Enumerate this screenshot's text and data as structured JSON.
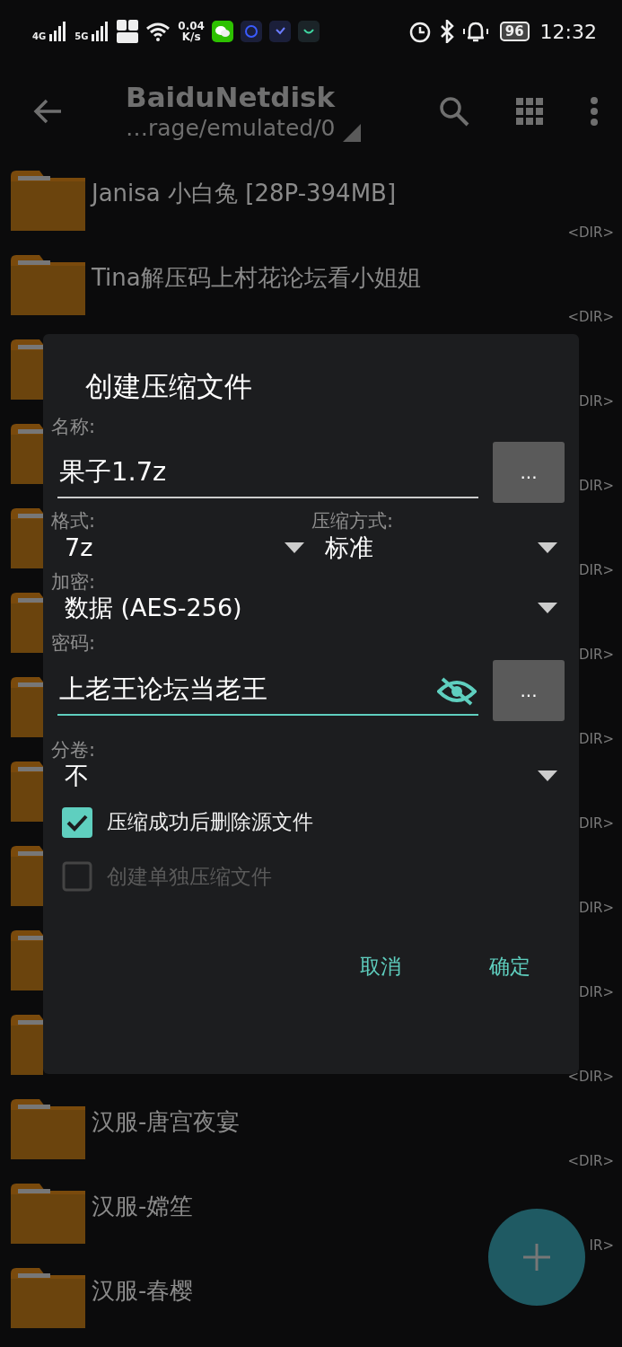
{
  "status_bar": {
    "networks": [
      "4G",
      "5G"
    ],
    "speed": "0.04",
    "speed_unit": "K/s",
    "battery": "96",
    "time": "12:32"
  },
  "app_bar": {
    "title": "BaiduNetdisk",
    "path": "…rage/emulated/0"
  },
  "files": [
    {
      "name": "Janisa 小白兔 [28P-394MB]",
      "dir": "<DIR>"
    },
    {
      "name": "Tina解压码上村花论坛看小姐姐",
      "dir": "<DIR>"
    },
    {
      "dir": "DIR>"
    },
    {
      "dir": "DIR>"
    },
    {
      "dir": "DIR>"
    },
    {
      "dir": "DIR>"
    },
    {
      "dir": "DIR>"
    },
    {
      "dir": "DIR>"
    },
    {
      "dir": "DIR>"
    },
    {
      "dir": "DIR>"
    },
    {
      "dir": "<DIR>"
    },
    {
      "name": "汉服-唐宫夜宴",
      "dir": "<DIR>"
    },
    {
      "name": "汉服-嫦笙",
      "dir": "IR>"
    },
    {
      "name": "汉服-春樱"
    }
  ],
  "dialog": {
    "title": "创建压缩文件",
    "name_label": "名称:",
    "name_value": "果子1.7z",
    "browse": "...",
    "format_label": "格式:",
    "format": "7z",
    "method_label": "压缩方式:",
    "method": "标准",
    "encryption_label": "加密:",
    "encryption": "数据 (AES-256)",
    "password_label": "密码:",
    "password": "上老王论坛当老王",
    "password_focused": true,
    "password_browse": "...",
    "volume_label": "分卷:",
    "volume": "不",
    "options": [
      {
        "label": "压缩成功后删除源文件",
        "checked": true,
        "disabled": false
      },
      {
        "label": "创建单独压缩文件",
        "checked": false,
        "disabled": true
      }
    ],
    "buttons": [
      "取消",
      "确定"
    ]
  }
}
